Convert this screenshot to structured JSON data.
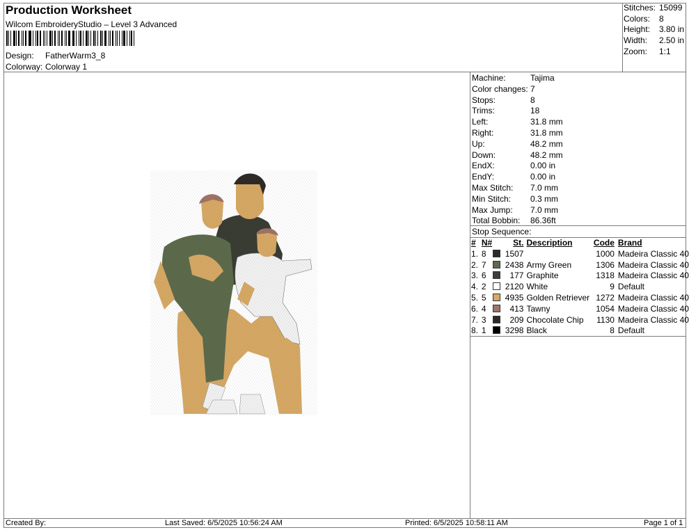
{
  "header": {
    "title": "Production Worksheet",
    "subtitle": "Wilcom EmbroideryStudio – Level 3 Advanced",
    "design_label": "Design:",
    "design_value": "FatherWarm3_8",
    "colorway_label": "Colorway:",
    "colorway_value": "Colorway 1"
  },
  "summary": {
    "stitches_label": "Stitches:",
    "stitches_value": "15099",
    "colors_label": "Colors:",
    "colors_value": "8",
    "height_label": "Height:",
    "height_value": "3.80 in",
    "width_label": "Width:",
    "width_value": "2.50 in",
    "zoom_label": "Zoom:",
    "zoom_value": "1:1"
  },
  "machine": [
    {
      "label": "Machine:",
      "value": "Tajima"
    },
    {
      "label": "Color changes:",
      "value": "7"
    },
    {
      "label": "Stops:",
      "value": "8"
    },
    {
      "label": "Trims:",
      "value": "18"
    },
    {
      "label": "Left:",
      "value": "31.8 mm"
    },
    {
      "label": "Right:",
      "value": "31.8 mm"
    },
    {
      "label": "Up:",
      "value": "48.2 mm"
    },
    {
      "label": "Down:",
      "value": "48.2 mm"
    },
    {
      "label": "EndX:",
      "value": "0.00 in"
    },
    {
      "label": "EndY:",
      "value": "0.00 in"
    },
    {
      "label": "Max Stitch:",
      "value": "7.0 mm"
    },
    {
      "label": "Min Stitch:",
      "value": "0.3 mm"
    },
    {
      "label": "Max Jump:",
      "value": "7.0 mm"
    },
    {
      "label": "Total Bobbin:",
      "value": "86.36ft"
    }
  ],
  "stop_sequence": {
    "title": "Stop Sequence:",
    "headers": {
      "num": "#",
      "n": "N#",
      "st": "St.",
      "desc": "Description",
      "code": "Code",
      "brand": "Brand"
    },
    "rows": [
      {
        "num": "1.",
        "n": "8",
        "color": "#2b2b2b",
        "st": "1507",
        "desc": "",
        "code": "1000",
        "brand": "Madeira Classic 40"
      },
      {
        "num": "2.",
        "n": "7",
        "color": "#5d6b4c",
        "st": "2438",
        "desc": "Army Green",
        "code": "1306",
        "brand": "Madeira Classic 40"
      },
      {
        "num": "3.",
        "n": "6",
        "color": "#3e3e3e",
        "st": "177",
        "desc": "Graphite",
        "code": "1318",
        "brand": "Madeira Classic 40"
      },
      {
        "num": "4.",
        "n": "2",
        "color": "#ffffff",
        "st": "2120",
        "desc": "White",
        "code": "9",
        "brand": "Default"
      },
      {
        "num": "5.",
        "n": "5",
        "color": "#d7a965",
        "st": "4935",
        "desc": "Golden Retriever",
        "code": "1272",
        "brand": "Madeira Classic 40"
      },
      {
        "num": "6.",
        "n": "4",
        "color": "#a07466",
        "st": "413",
        "desc": "Tawny",
        "code": "1054",
        "brand": "Madeira Classic 40"
      },
      {
        "num": "7.",
        "n": "3",
        "color": "#2e2a27",
        "st": "209",
        "desc": "Chocolate Chip",
        "code": "1130",
        "brand": "Madeira Classic 40"
      },
      {
        "num": "8.",
        "n": "1",
        "color": "#000000",
        "st": "3298",
        "desc": "Black",
        "code": "8",
        "brand": "Default"
      }
    ]
  },
  "footer": {
    "created_by": "Created By:",
    "last_saved": "Last Saved: 6/5/2025 10:56:24 AM",
    "printed": "Printed: 6/5/2025 10:58:11 AM",
    "page": "Page 1 of 1"
  },
  "colors": {
    "skin": "#d7a965",
    "green": "#5d6b4c",
    "dark": "#2e2a27",
    "white": "#f2f2f2"
  }
}
